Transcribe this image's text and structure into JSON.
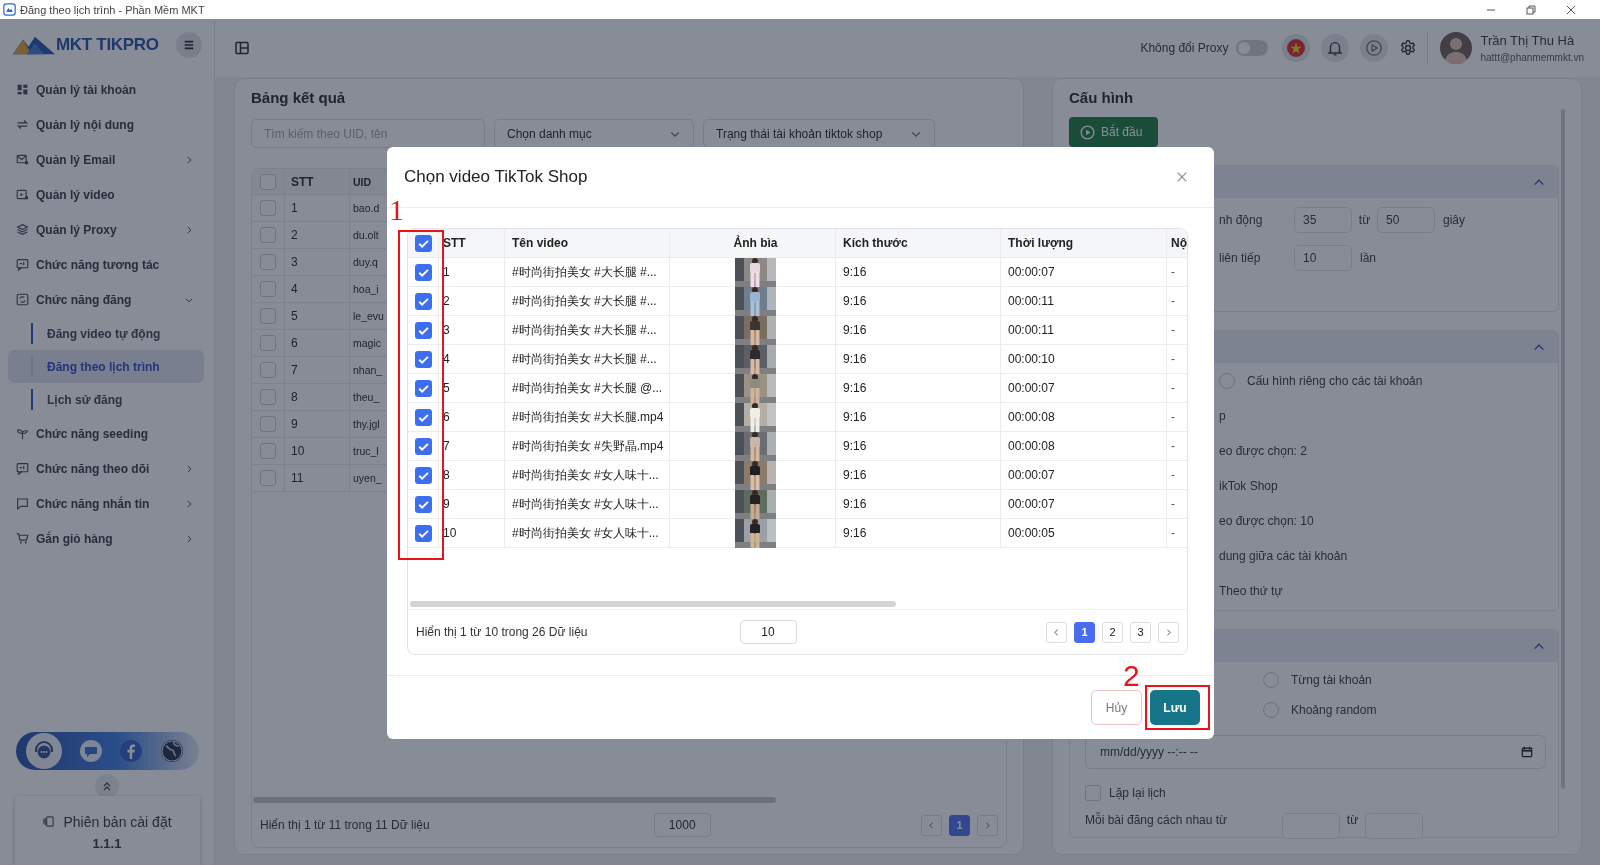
{
  "window": {
    "title": "Đăng theo lịch trình - Phần Mềm MKT"
  },
  "sidebar": {
    "logo": "MKT TIKPRO",
    "items": [
      {
        "label": "Quản lý tài khoản",
        "has_submenu": false
      },
      {
        "label": "Quản lý nội dung",
        "has_submenu": false
      },
      {
        "label": "Quản lý Email",
        "has_submenu": true,
        "expanded": false
      },
      {
        "label": "Quản lý video",
        "has_submenu": false
      },
      {
        "label": "Quản lý Proxy",
        "has_submenu": true,
        "expanded": false
      },
      {
        "label": "Chức năng tương tác",
        "has_submenu": false
      },
      {
        "label": "Chức năng đăng",
        "has_submenu": true,
        "expanded": true,
        "children": [
          {
            "label": "Đăng video tự động",
            "selected": false
          },
          {
            "label": "Đăng theo lịch trình",
            "selected": true
          },
          {
            "label": "Lịch sử đăng",
            "selected": false
          }
        ]
      },
      {
        "label": "Chức năng seeding",
        "has_submenu": false
      },
      {
        "label": "Chức năng theo dõi",
        "has_submenu": true,
        "expanded": false
      },
      {
        "label": "Chức năng nhắn tin",
        "has_submenu": true,
        "expanded": false
      },
      {
        "label": "Gắn giỏ hàng",
        "has_submenu": true,
        "expanded": false
      }
    ],
    "version": {
      "label": "Phiên bản cài đặt",
      "number": "1.1.1"
    }
  },
  "header": {
    "proxy_label": "Không đổi Proxy",
    "proxy_on": false,
    "user": {
      "name": "Trần Thị Thu Hà",
      "email": "hattt@phanmemmkt.vn"
    }
  },
  "results": {
    "title": "Bảng kết quả",
    "search_placeholder": "Tìm kiếm theo UID, tên",
    "filters": [
      "Chọn danh mục",
      "Trạng thái tài khoản tiktok shop"
    ],
    "columns": [
      "STT",
      "UID"
    ],
    "select_all": false,
    "rows": [
      {
        "stt": "1",
        "uid": "bao.d",
        "checked": false
      },
      {
        "stt": "2",
        "uid": "du.olt",
        "checked": false
      },
      {
        "stt": "3",
        "uid": "duy.q",
        "checked": false
      },
      {
        "stt": "4",
        "uid": "hoa_i",
        "checked": false
      },
      {
        "stt": "5",
        "uid": "le_evu",
        "checked": false
      },
      {
        "stt": "6",
        "uid": "magic",
        "checked": false
      },
      {
        "stt": "7",
        "uid": "nhan_",
        "checked": false
      },
      {
        "stt": "8",
        "uid": "theu_",
        "checked": false
      },
      {
        "stt": "9",
        "uid": "thy.jgl",
        "checked": false
      },
      {
        "stt": "10",
        "uid": "truc_l",
        "checked": false
      },
      {
        "stt": "11",
        "uid": "uyen_",
        "checked": false
      }
    ],
    "footer": "Hiển thị 1 từ 11 trong 11 Dữ liệu",
    "page_size": "1000",
    "pages": [
      {
        "label": "1",
        "selected": true
      }
    ]
  },
  "config": {
    "title": "Cấu hình",
    "start_button": "Bắt đầu",
    "sections": [
      {
        "expanded": true,
        "rows": [
          {
            "kind": "inputs",
            "label": "nh động",
            "values": [
              "35",
              "50"
            ],
            "joiner": "từ",
            "unit": "giây"
          },
          {
            "kind": "inputs",
            "label": "liên tiếp",
            "values": [
              "10"
            ],
            "unit": "lần"
          }
        ]
      },
      {
        "expanded": true,
        "rows": [
          {
            "kind": "radio",
            "label": "Cấu hình riêng cho các tài khoản",
            "selected": false
          },
          {
            "kind": "text",
            "label": "p"
          },
          {
            "kind": "text",
            "label": "eo được chọn: 2"
          },
          {
            "kind": "text",
            "label": "ikTok Shop"
          },
          {
            "kind": "text",
            "label": "eo được chọn: 10"
          },
          {
            "kind": "text",
            "label": "dung giữa các tài khoản"
          },
          {
            "kind": "text",
            "label": "Theo thứ tự"
          }
        ]
      },
      {
        "expanded": true,
        "rows": [
          {
            "kind": "radio",
            "label": "Từng tài khoản",
            "selected": false
          },
          {
            "kind": "radio",
            "label": "Khoảng random",
            "selected": false
          },
          {
            "kind": "date",
            "placeholder": "mm/dd/yyyy --:-- --"
          },
          {
            "kind": "checkbox",
            "label": "Lặp lại lịch",
            "checked": false
          },
          {
            "kind": "range",
            "label": "Mỗi bài đăng cách nhau từ",
            "joiner": "từ"
          }
        ]
      }
    ]
  },
  "modal": {
    "title": "Chọn video TikTok Shop",
    "columns": [
      "STT",
      "Tên video",
      "Ảnh bìa",
      "Kích thước",
      "Thời lượng",
      "Nộ"
    ],
    "select_all": true,
    "rows": [
      {
        "stt": "1",
        "name": "#时尚街拍美女 #大长腿 #...",
        "size": "9:16",
        "duration": "00:00:07",
        "content": "-",
        "checked": true
      },
      {
        "stt": "2",
        "name": "#时尚街拍美女 #大长腿 #...",
        "size": "9:16",
        "duration": "00:00:11",
        "content": "-",
        "checked": true
      },
      {
        "stt": "3",
        "name": "#时尚街拍美女 #大长腿 #...",
        "size": "9:16",
        "duration": "00:00:11",
        "content": "-",
        "checked": true
      },
      {
        "stt": "4",
        "name": "#时尚街拍美女 #大长腿 #...",
        "size": "9:16",
        "duration": "00:00:10",
        "content": "-",
        "checked": true
      },
      {
        "stt": "5",
        "name": "#时尚街拍美女 #大长腿 @...",
        "size": "9:16",
        "duration": "00:00:07",
        "content": "-",
        "checked": true
      },
      {
        "stt": "6",
        "name": "#时尚街拍美女 #大长腿.mp4",
        "size": "9:16",
        "duration": "00:00:08",
        "content": "-",
        "checked": true
      },
      {
        "stt": "7",
        "name": "#时尚街拍美女 #失野晶.mp4",
        "size": "9:16",
        "duration": "00:00:08",
        "content": "-",
        "checked": true
      },
      {
        "stt": "8",
        "name": "#时尚街拍美女 #女人味十...",
        "size": "9:16",
        "duration": "00:00:07",
        "content": "-",
        "checked": true
      },
      {
        "stt": "9",
        "name": "#时尚街拍美女 #女人味十...",
        "size": "9:16",
        "duration": "00:00:07",
        "content": "-",
        "checked": true
      },
      {
        "stt": "10",
        "name": "#时尚街拍美女 #女人味十...",
        "size": "9:16",
        "duration": "00:00:05",
        "content": "-",
        "checked": true
      }
    ],
    "footer": "Hiển thị 1 từ 10 trong 26 Dữ liệu",
    "page_size": "10",
    "pages": [
      {
        "label": "1",
        "selected": true
      },
      {
        "label": "2",
        "selected": false
      },
      {
        "label": "3",
        "selected": false
      }
    ],
    "cancel_button": "Hủy",
    "save_button": "Lưu"
  },
  "annotations": [
    {
      "label": "1"
    },
    {
      "label": "2"
    }
  ]
}
